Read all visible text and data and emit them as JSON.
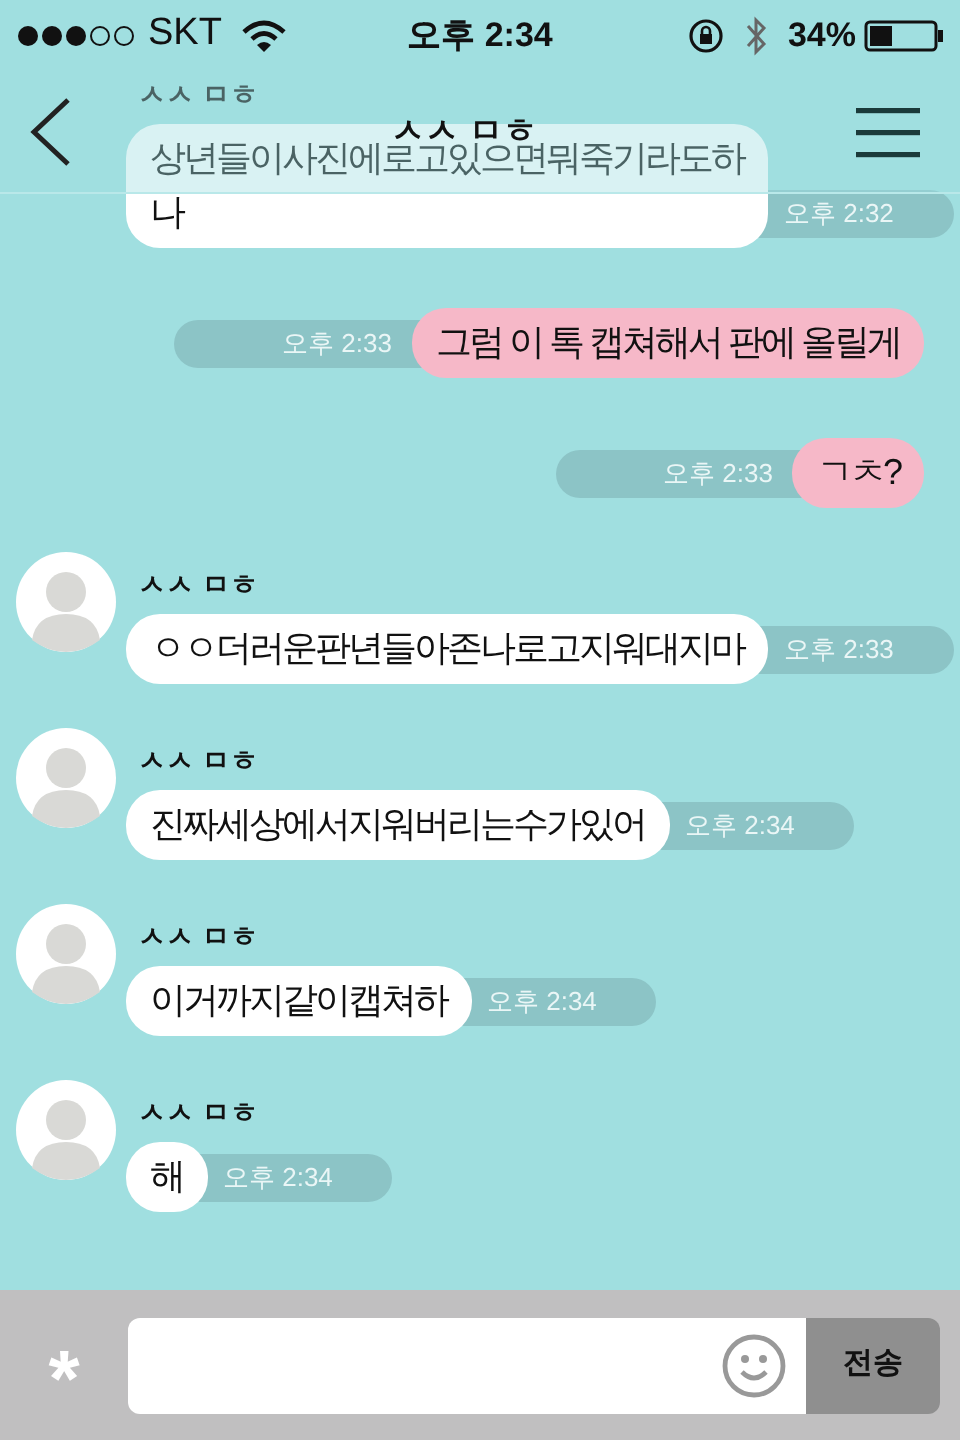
{
  "status_bar": {
    "carrier": "SKT",
    "time": "오후 2:34",
    "battery": "34%"
  },
  "header": {
    "title": "ㅅㅅ ㅁㅎ"
  },
  "messages": [
    {
      "kind": "received",
      "avatar": false,
      "sender": "ㅅㅅ ㅁㅎ",
      "lines": [
        "상년들이사진에로고있으면뭐죽기라도하",
        "나"
      ],
      "time": "오후 2:32"
    },
    {
      "kind": "sent",
      "lines": [
        "그럼 이 톡 캡쳐해서 판에 올릴게"
      ],
      "time": "오후 2:33"
    },
    {
      "kind": "sent",
      "lines": [
        "ㄱㅊ?"
      ],
      "time": "오후 2:33"
    },
    {
      "kind": "received",
      "avatar": true,
      "sender": "ㅅㅅ ㅁㅎ",
      "lines": [
        "ㅇㅇ더러운판년들아존나로고지워대지마"
      ],
      "time": "오후 2:33"
    },
    {
      "kind": "received",
      "avatar": true,
      "sender": "ㅅㅅ ㅁㅎ",
      "lines": [
        "진짜세상에서지워버리는수가있어"
      ],
      "time": "오후 2:34"
    },
    {
      "kind": "received",
      "avatar": true,
      "sender": "ㅅㅅ ㅁㅎ",
      "lines": [
        "이거까지같이캡쳐하"
      ],
      "time": "오후 2:34"
    },
    {
      "kind": "received",
      "avatar": true,
      "sender": "ㅅㅅ ㅁㅎ",
      "lines": [
        "해"
      ],
      "time": "오후 2:34"
    }
  ],
  "composer": {
    "attach": "*",
    "send": "전송"
  }
}
